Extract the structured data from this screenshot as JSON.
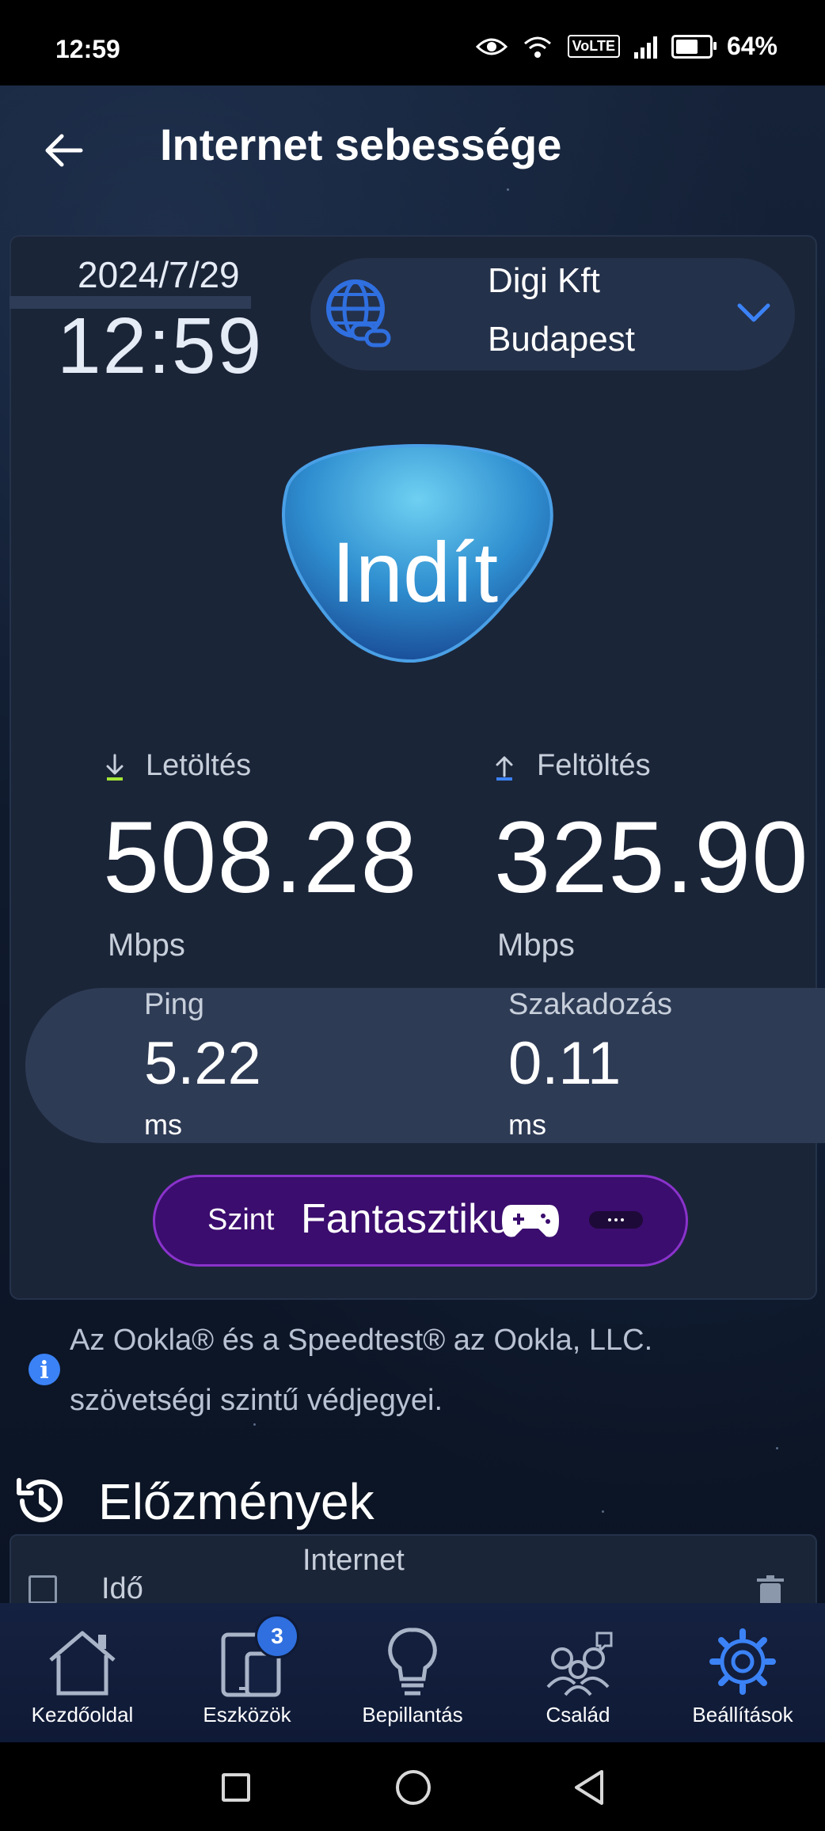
{
  "status_bar": {
    "time": "12:59",
    "volte": "VoLTE",
    "battery": "64%",
    "battery_level": 0.64
  },
  "header": {
    "title": "Internet sebessége",
    "back_icon": "arrow-left-icon"
  },
  "test": {
    "date": "2024/7/29",
    "time": "12:59",
    "server": {
      "provider": "Digi Kft",
      "city": "Budapest"
    },
    "start_label": "Indít",
    "download": {
      "label": "Letöltés",
      "value": "508.28",
      "unit": "Mbps"
    },
    "upload": {
      "label": "Feltöltés",
      "value": "325.90",
      "unit": "Mbps"
    },
    "ping": {
      "label": "Ping",
      "value": "5.22",
      "unit": "ms"
    },
    "jitter": {
      "label": "Szakadozás",
      "value": "0.11",
      "unit": "ms"
    },
    "level": {
      "label": "Szint",
      "value": "Fantasztikus"
    }
  },
  "colors": {
    "download_arrow": "#a3e635",
    "upload_arrow": "#3b82f6",
    "accent": "#3b82f6",
    "level_bg": "#3b0d6e"
  },
  "info": {
    "line1": "Az Ookla® és a Speedtest® az Ookla, LLC.",
    "line2": "szövetségi szintű védjegyei."
  },
  "history": {
    "title": "Előzmények",
    "column_internet": "Internet",
    "column_time": "Idő"
  },
  "nav": {
    "items": [
      {
        "label": "Kezdőoldal",
        "icon": "home-icon"
      },
      {
        "label": "Eszközök",
        "icon": "devices-icon",
        "badge": "3"
      },
      {
        "label": "Bepillantás",
        "icon": "lightbulb-icon"
      },
      {
        "label": "Család",
        "icon": "family-icon"
      },
      {
        "label": "Beállítások",
        "icon": "gear-icon",
        "active": true
      }
    ]
  }
}
